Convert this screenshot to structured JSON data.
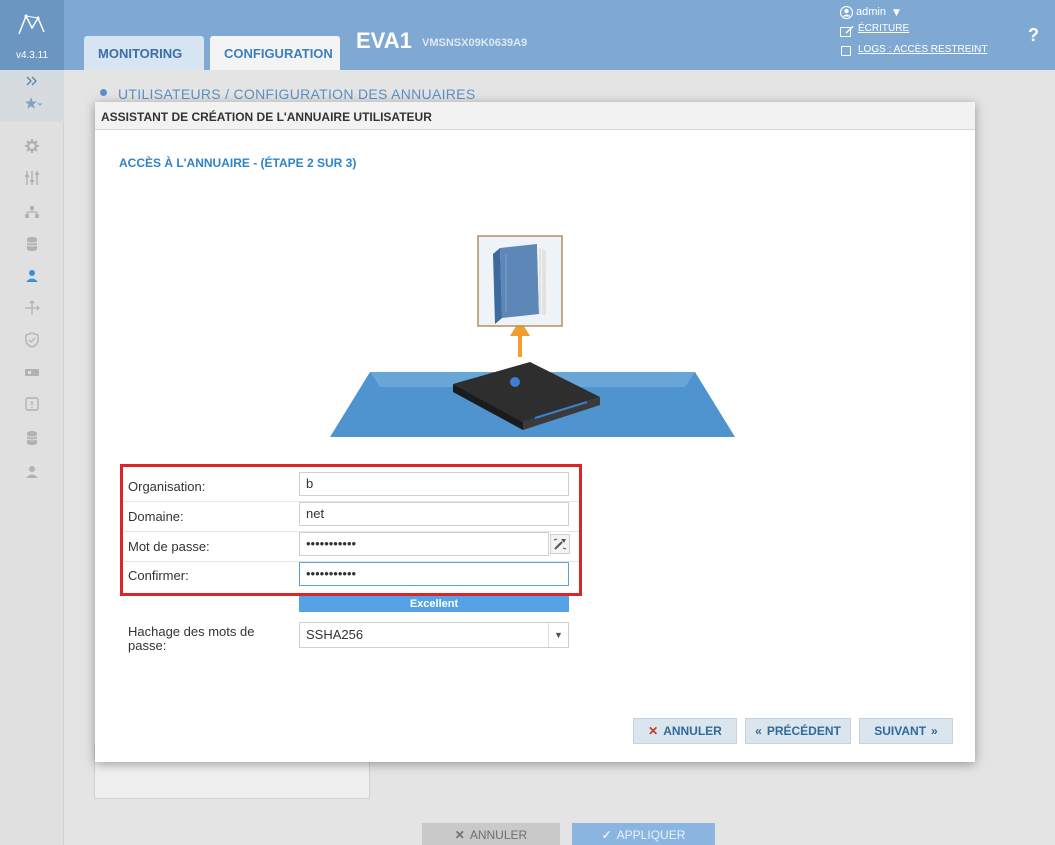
{
  "header": {
    "version": "v4.3.11",
    "tabs": [
      {
        "label": "MONITORING",
        "active": false
      },
      {
        "label": "CONFIGURATION",
        "active": true
      }
    ],
    "device_name": "EVA1",
    "device_serial": "VMSNSX09K0639A9",
    "user": {
      "name": "admin",
      "write_mode": "ÉCRITURE",
      "logs_access": "LOGS : ACCÈS RESTREINT"
    },
    "help": "?"
  },
  "sidebar": {
    "expand_icon": "double-chevron-right-icon",
    "items": [
      {
        "icon": "star-icon"
      },
      {
        "icon": "gear-icon"
      },
      {
        "icon": "sliders-icon"
      },
      {
        "icon": "network-icon"
      },
      {
        "icon": "database-icon"
      },
      {
        "icon": "user-icon",
        "active": true
      },
      {
        "icon": "routing-icon"
      },
      {
        "icon": "shield-icon"
      },
      {
        "icon": "vpn-icon"
      },
      {
        "icon": "alert-icon"
      },
      {
        "icon": "database-icon"
      },
      {
        "icon": "user-icon"
      }
    ]
  },
  "background": {
    "breadcrumb": "UTILISATEURS / CONFIGURATION DES ANNUAIRES",
    "cancel_label": "ANNULER",
    "apply_label": "APPLIQUER"
  },
  "modal": {
    "title": "ASSISTANT DE CRÉATION DE L'ANNUAIRE UTILISATEUR",
    "step_title": "ACCÈS À L'ANNUAIRE - (ÉTAPE 2 SUR 3)",
    "fields": {
      "organisation": {
        "label": "Organisation:",
        "value": "b"
      },
      "domaine": {
        "label": "Domaine:",
        "value": "net"
      },
      "mot_de_passe": {
        "label": "Mot de passe:",
        "value": "•••••••••••"
      },
      "confirmer": {
        "label": "Confirmer:",
        "value": "•••••••••••"
      }
    },
    "strength": "Excellent",
    "hash": {
      "label": "Hachage des mots de passe:",
      "value": "SSHA256"
    },
    "buttons": {
      "cancel": "ANNULER",
      "previous": "PRÉCÉDENT",
      "next": "SUIVANT"
    }
  },
  "colors": {
    "header_bg": "#7fa9d2",
    "accent": "#2f83c9",
    "highlight": "#d9262b",
    "strength_bar": "#55a3e6"
  }
}
